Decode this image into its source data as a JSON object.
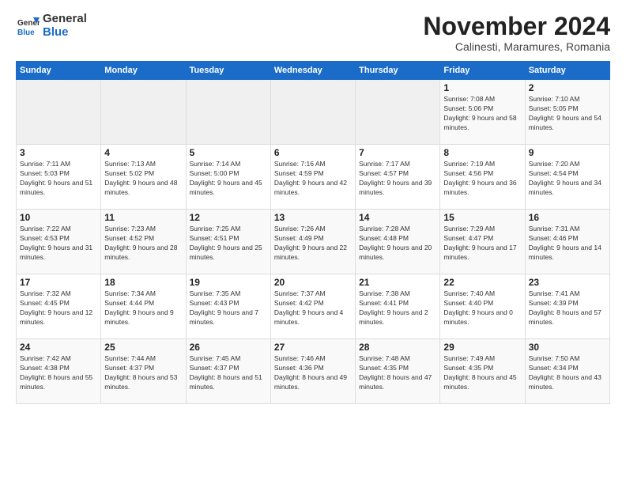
{
  "logo": {
    "general": "General",
    "blue": "Blue"
  },
  "title": {
    "main": "November 2024",
    "sub": "Calinesti, Maramures, Romania"
  },
  "headers": [
    "Sunday",
    "Monday",
    "Tuesday",
    "Wednesday",
    "Thursday",
    "Friday",
    "Saturday"
  ],
  "weeks": [
    [
      {
        "day": "",
        "info": ""
      },
      {
        "day": "",
        "info": ""
      },
      {
        "day": "",
        "info": ""
      },
      {
        "day": "",
        "info": ""
      },
      {
        "day": "",
        "info": ""
      },
      {
        "day": "1",
        "info": "Sunrise: 7:08 AM\nSunset: 5:06 PM\nDaylight: 9 hours and 58 minutes."
      },
      {
        "day": "2",
        "info": "Sunrise: 7:10 AM\nSunset: 5:05 PM\nDaylight: 9 hours and 54 minutes."
      }
    ],
    [
      {
        "day": "3",
        "info": "Sunrise: 7:11 AM\nSunset: 5:03 PM\nDaylight: 9 hours and 51 minutes."
      },
      {
        "day": "4",
        "info": "Sunrise: 7:13 AM\nSunset: 5:02 PM\nDaylight: 9 hours and 48 minutes."
      },
      {
        "day": "5",
        "info": "Sunrise: 7:14 AM\nSunset: 5:00 PM\nDaylight: 9 hours and 45 minutes."
      },
      {
        "day": "6",
        "info": "Sunrise: 7:16 AM\nSunset: 4:59 PM\nDaylight: 9 hours and 42 minutes."
      },
      {
        "day": "7",
        "info": "Sunrise: 7:17 AM\nSunset: 4:57 PM\nDaylight: 9 hours and 39 minutes."
      },
      {
        "day": "8",
        "info": "Sunrise: 7:19 AM\nSunset: 4:56 PM\nDaylight: 9 hours and 36 minutes."
      },
      {
        "day": "9",
        "info": "Sunrise: 7:20 AM\nSunset: 4:54 PM\nDaylight: 9 hours and 34 minutes."
      }
    ],
    [
      {
        "day": "10",
        "info": "Sunrise: 7:22 AM\nSunset: 4:53 PM\nDaylight: 9 hours and 31 minutes."
      },
      {
        "day": "11",
        "info": "Sunrise: 7:23 AM\nSunset: 4:52 PM\nDaylight: 9 hours and 28 minutes."
      },
      {
        "day": "12",
        "info": "Sunrise: 7:25 AM\nSunset: 4:51 PM\nDaylight: 9 hours and 25 minutes."
      },
      {
        "day": "13",
        "info": "Sunrise: 7:26 AM\nSunset: 4:49 PM\nDaylight: 9 hours and 22 minutes."
      },
      {
        "day": "14",
        "info": "Sunrise: 7:28 AM\nSunset: 4:48 PM\nDaylight: 9 hours and 20 minutes."
      },
      {
        "day": "15",
        "info": "Sunrise: 7:29 AM\nSunset: 4:47 PM\nDaylight: 9 hours and 17 minutes."
      },
      {
        "day": "16",
        "info": "Sunrise: 7:31 AM\nSunset: 4:46 PM\nDaylight: 9 hours and 14 minutes."
      }
    ],
    [
      {
        "day": "17",
        "info": "Sunrise: 7:32 AM\nSunset: 4:45 PM\nDaylight: 9 hours and 12 minutes."
      },
      {
        "day": "18",
        "info": "Sunrise: 7:34 AM\nSunset: 4:44 PM\nDaylight: 9 hours and 9 minutes."
      },
      {
        "day": "19",
        "info": "Sunrise: 7:35 AM\nSunset: 4:43 PM\nDaylight: 9 hours and 7 minutes."
      },
      {
        "day": "20",
        "info": "Sunrise: 7:37 AM\nSunset: 4:42 PM\nDaylight: 9 hours and 4 minutes."
      },
      {
        "day": "21",
        "info": "Sunrise: 7:38 AM\nSunset: 4:41 PM\nDaylight: 9 hours and 2 minutes."
      },
      {
        "day": "22",
        "info": "Sunrise: 7:40 AM\nSunset: 4:40 PM\nDaylight: 9 hours and 0 minutes."
      },
      {
        "day": "23",
        "info": "Sunrise: 7:41 AM\nSunset: 4:39 PM\nDaylight: 8 hours and 57 minutes."
      }
    ],
    [
      {
        "day": "24",
        "info": "Sunrise: 7:42 AM\nSunset: 4:38 PM\nDaylight: 8 hours and 55 minutes."
      },
      {
        "day": "25",
        "info": "Sunrise: 7:44 AM\nSunset: 4:37 PM\nDaylight: 8 hours and 53 minutes."
      },
      {
        "day": "26",
        "info": "Sunrise: 7:45 AM\nSunset: 4:37 PM\nDaylight: 8 hours and 51 minutes."
      },
      {
        "day": "27",
        "info": "Sunrise: 7:46 AM\nSunset: 4:36 PM\nDaylight: 8 hours and 49 minutes."
      },
      {
        "day": "28",
        "info": "Sunrise: 7:48 AM\nSunset: 4:35 PM\nDaylight: 8 hours and 47 minutes."
      },
      {
        "day": "29",
        "info": "Sunrise: 7:49 AM\nSunset: 4:35 PM\nDaylight: 8 hours and 45 minutes."
      },
      {
        "day": "30",
        "info": "Sunrise: 7:50 AM\nSunset: 4:34 PM\nDaylight: 8 hours and 43 minutes."
      }
    ]
  ]
}
